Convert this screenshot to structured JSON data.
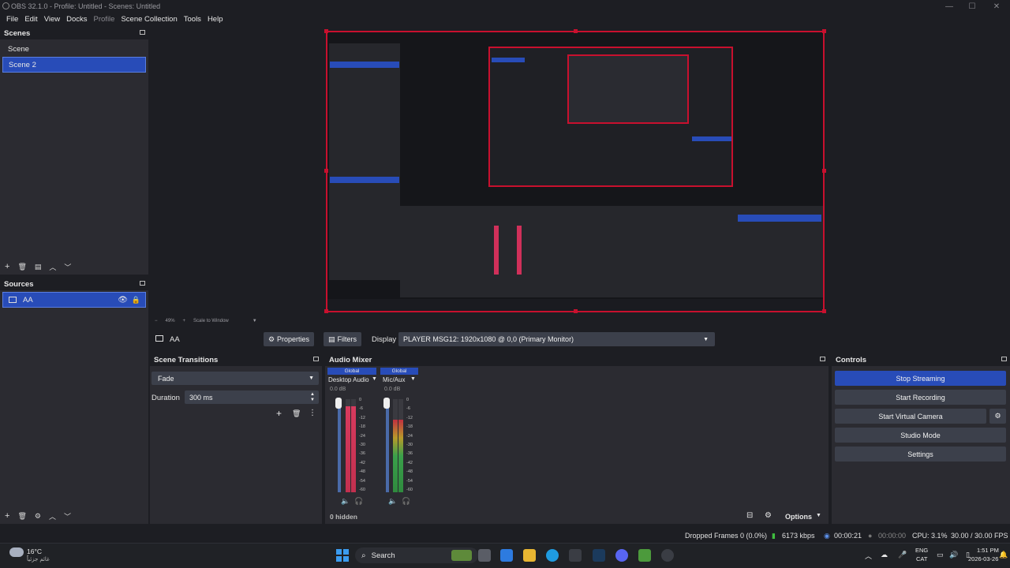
{
  "window": {
    "title": "OBS 32.1.0 - Profile: Untitled - Scenes: Untitled"
  },
  "menu": [
    "File",
    "Edit",
    "View",
    "Docks",
    "Profile",
    "Scene Collection",
    "Tools",
    "Help"
  ],
  "scenes": {
    "title": "Scenes",
    "items": [
      "Scene",
      "Scene 2"
    ],
    "selected": 1
  },
  "sources": {
    "title": "Sources",
    "items": [
      {
        "name": "AA"
      }
    ]
  },
  "preview_bar": {
    "zoom": "49%",
    "scale": "Scale to Window"
  },
  "source_toolbar": {
    "source_name": "AA",
    "properties": "Properties",
    "filters": "Filters",
    "display_label": "Display",
    "display_value": "PLAYER MSG12: 1920x1080 @ 0,0 (Primary Monitor)"
  },
  "scene_transitions": {
    "title": "Scene Transitions",
    "transition": "Fade",
    "duration_label": "Duration",
    "duration_value": "300 ms"
  },
  "audio_mixer": {
    "title": "Audio Mixer",
    "channels": [
      {
        "badge": "Global",
        "name": "Desktop Audio",
        "db": "0.0 dB",
        "level": 0.92
      },
      {
        "badge": "Global",
        "name": "Mic/Aux",
        "db": "0.0 dB",
        "level": 0.78
      }
    ],
    "scale": [
      "0",
      "-6",
      "-12",
      "-18",
      "-24",
      "-30",
      "-36",
      "-42",
      "-48",
      "-54",
      "-60"
    ],
    "hidden": "0 hidden",
    "options": "Options"
  },
  "controls": {
    "title": "Controls",
    "buttons": [
      "Stop Streaming",
      "Start Recording",
      "Start Virtual Camera",
      "Studio Mode",
      "Settings"
    ]
  },
  "status_bar": {
    "dropped": "Dropped Frames 0 (0.0%)",
    "bitrate": "6173 kbps",
    "stream_time": "00:00:21",
    "rec_time": "00:00:00",
    "cpu": "CPU: 3.1%",
    "fps": "30.00 / 30.00 FPS"
  },
  "taskbar": {
    "weather_temp": "16°C",
    "weather_desc": "غائم جزئياً",
    "search": "Search",
    "lang_top": "ENG",
    "lang_bottom": "CAT",
    "time": "1:51 PM",
    "date": "2026-03-26"
  },
  "colors": {
    "accent": "#284cb8",
    "preview_border": "#c8102e",
    "panel": "#2b2b31",
    "background": "#1d1e23"
  }
}
